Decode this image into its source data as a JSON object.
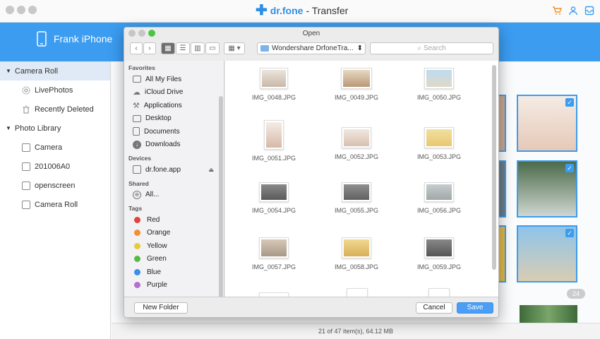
{
  "app": {
    "brand_name": "dr.fone",
    "brand_suffix": "- Transfer",
    "device_name": "Frank iPhone",
    "status": "21 of 47 item(s), 64.12 MB",
    "badge_count": "24"
  },
  "sidebar": {
    "sections": [
      {
        "label": "Camera Roll",
        "items": [
          "LivePhotos",
          "Recently Deleted"
        ]
      },
      {
        "label": "Photo Library",
        "items": [
          "Camera",
          "201006A0",
          "openscreen",
          "Camera Roll"
        ]
      }
    ]
  },
  "dialog": {
    "title": "Open",
    "path": "Wondershare DrfoneTra...",
    "search_placeholder": "Search",
    "favorites_header": "Favorites",
    "favorites": [
      "All My Files",
      "iCloud Drive",
      "Applications",
      "Desktop",
      "Documents",
      "Downloads"
    ],
    "devices_header": "Devices",
    "devices": [
      "dr.fone.app"
    ],
    "shared_header": "Shared",
    "shared": [
      "All..."
    ],
    "tags_header": "Tags",
    "tags": [
      {
        "label": "Red",
        "color": "#e0443a"
      },
      {
        "label": "Orange",
        "color": "#f0922e"
      },
      {
        "label": "Yellow",
        "color": "#e8c93a"
      },
      {
        "label": "Green",
        "color": "#5ab946"
      },
      {
        "label": "Blue",
        "color": "#3b8ee8"
      },
      {
        "label": "Purple",
        "color": "#b46fd0"
      }
    ],
    "files": [
      "IMG_0048.JPG",
      "IMG_0049.JPG",
      "IMG_0050.JPG",
      "IMG_0051.JPG",
      "IMG_0052.JPG",
      "IMG_0053.JPG",
      "IMG_0054.JPG",
      "IMG_0055.JPG",
      "IMG_0056.JPG",
      "IMG_0057.JPG",
      "IMG_0058.JPG",
      "IMG_0059.JPG"
    ],
    "new_folder_label": "New Folder",
    "cancel_label": "Cancel",
    "save_label": "Save"
  },
  "colors": {
    "accent": "#3b9cf0"
  }
}
